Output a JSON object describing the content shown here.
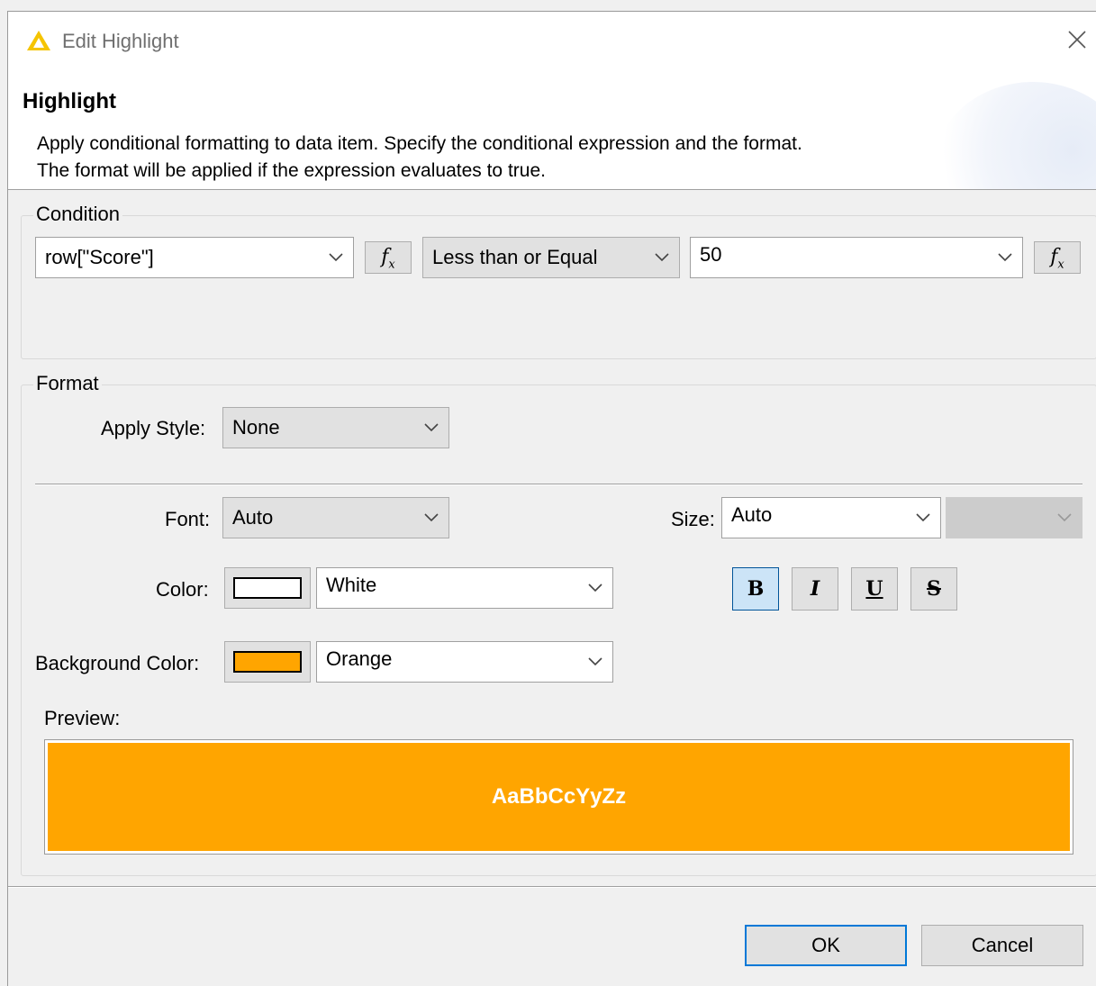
{
  "window": {
    "title": "Edit Highlight"
  },
  "header": {
    "title": "Highlight",
    "description_line1": "Apply conditional formatting to data item. Specify the conditional expression and the format.",
    "description_line2": "The format will be applied if the expression evaluates to true."
  },
  "condition": {
    "group_label": "Condition",
    "expression": "row[\"Score\"]",
    "operator": "Less than or Equal",
    "value": "50",
    "fx_label": "f",
    "fx_sub": "x"
  },
  "format": {
    "group_label": "Format",
    "apply_style_label": "Apply Style:",
    "apply_style_value": "None",
    "font_label": "Font:",
    "font_value": "Auto",
    "size_label": "Size:",
    "size_value": "Auto",
    "size_unit_value": "",
    "color_label": "Color:",
    "color_value": "White",
    "color_hex": "#ffffff",
    "bg_color_label": "Background Color:",
    "bg_color_value": "Orange",
    "bg_color_hex": "#ffa500",
    "bold_label": "B",
    "italic_label": "I",
    "underline_label": "U",
    "strike_label": "S",
    "bold_active": true
  },
  "preview": {
    "label": "Preview:",
    "sample_text": "AaBbCcYyZz"
  },
  "buttons": {
    "ok": "OK",
    "cancel": "Cancel"
  }
}
